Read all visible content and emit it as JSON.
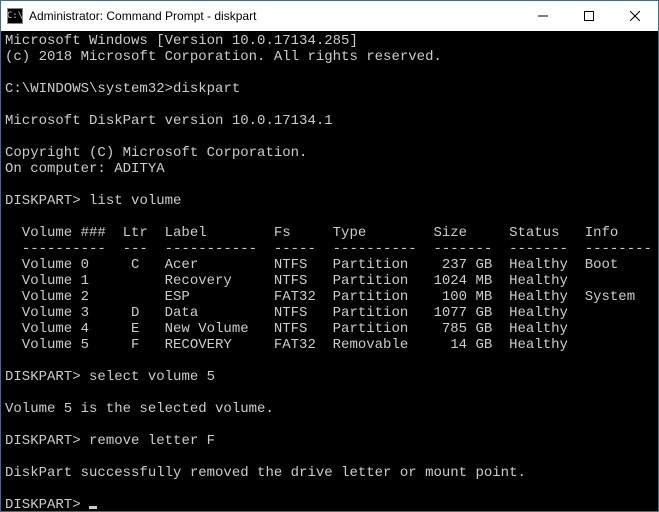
{
  "titlebar": {
    "icon_label": "C:\\",
    "title": "Administrator: Command Prompt - diskpart"
  },
  "header": {
    "version_line": "Microsoft Windows [Version 10.0.17134.285]",
    "copyright_line": "(c) 2018 Microsoft Corporation. All rights reserved."
  },
  "prompt_path": "C:\\WINDOWS\\system32>",
  "cmd_diskpart": "diskpart",
  "diskpart_version": "Microsoft DiskPart version 10.0.17134.1",
  "diskpart_copyright": "Copyright (C) Microsoft Corporation.",
  "computer_line": "On computer: ADITYA",
  "dp_prompt": "DISKPART>",
  "cmd_list": "list volume",
  "table": {
    "headers": {
      "vol": "Volume ###",
      "ltr": "Ltr",
      "label": "Label",
      "fs": "Fs",
      "type": "Type",
      "size": "Size",
      "status": "Status",
      "info": "Info"
    },
    "rows": [
      {
        "vol": "Volume 0",
        "ltr": "C",
        "label": "Acer",
        "fs": "NTFS",
        "type": "Partition",
        "size": "237 GB",
        "status": "Healthy",
        "info": "Boot"
      },
      {
        "vol": "Volume 1",
        "ltr": "",
        "label": "Recovery",
        "fs": "NTFS",
        "type": "Partition",
        "size": "1024 MB",
        "status": "Healthy",
        "info": ""
      },
      {
        "vol": "Volume 2",
        "ltr": "",
        "label": "ESP",
        "fs": "FAT32",
        "type": "Partition",
        "size": "100 MB",
        "status": "Healthy",
        "info": "System"
      },
      {
        "vol": "Volume 3",
        "ltr": "D",
        "label": "Data",
        "fs": "NTFS",
        "type": "Partition",
        "size": "1077 GB",
        "status": "Healthy",
        "info": ""
      },
      {
        "vol": "Volume 4",
        "ltr": "E",
        "label": "New Volume",
        "fs": "NTFS",
        "type": "Partition",
        "size": "785 GB",
        "status": "Healthy",
        "info": ""
      },
      {
        "vol": "Volume 5",
        "ltr": "F",
        "label": "RECOVERY",
        "fs": "FAT32",
        "type": "Removable",
        "size": "14 GB",
        "status": "Healthy",
        "info": ""
      }
    ]
  },
  "cmd_select": "select volume 5",
  "select_response": "Volume 5 is the selected volume.",
  "cmd_remove": "remove letter F",
  "remove_response": "DiskPart successfully removed the drive letter or mount point."
}
